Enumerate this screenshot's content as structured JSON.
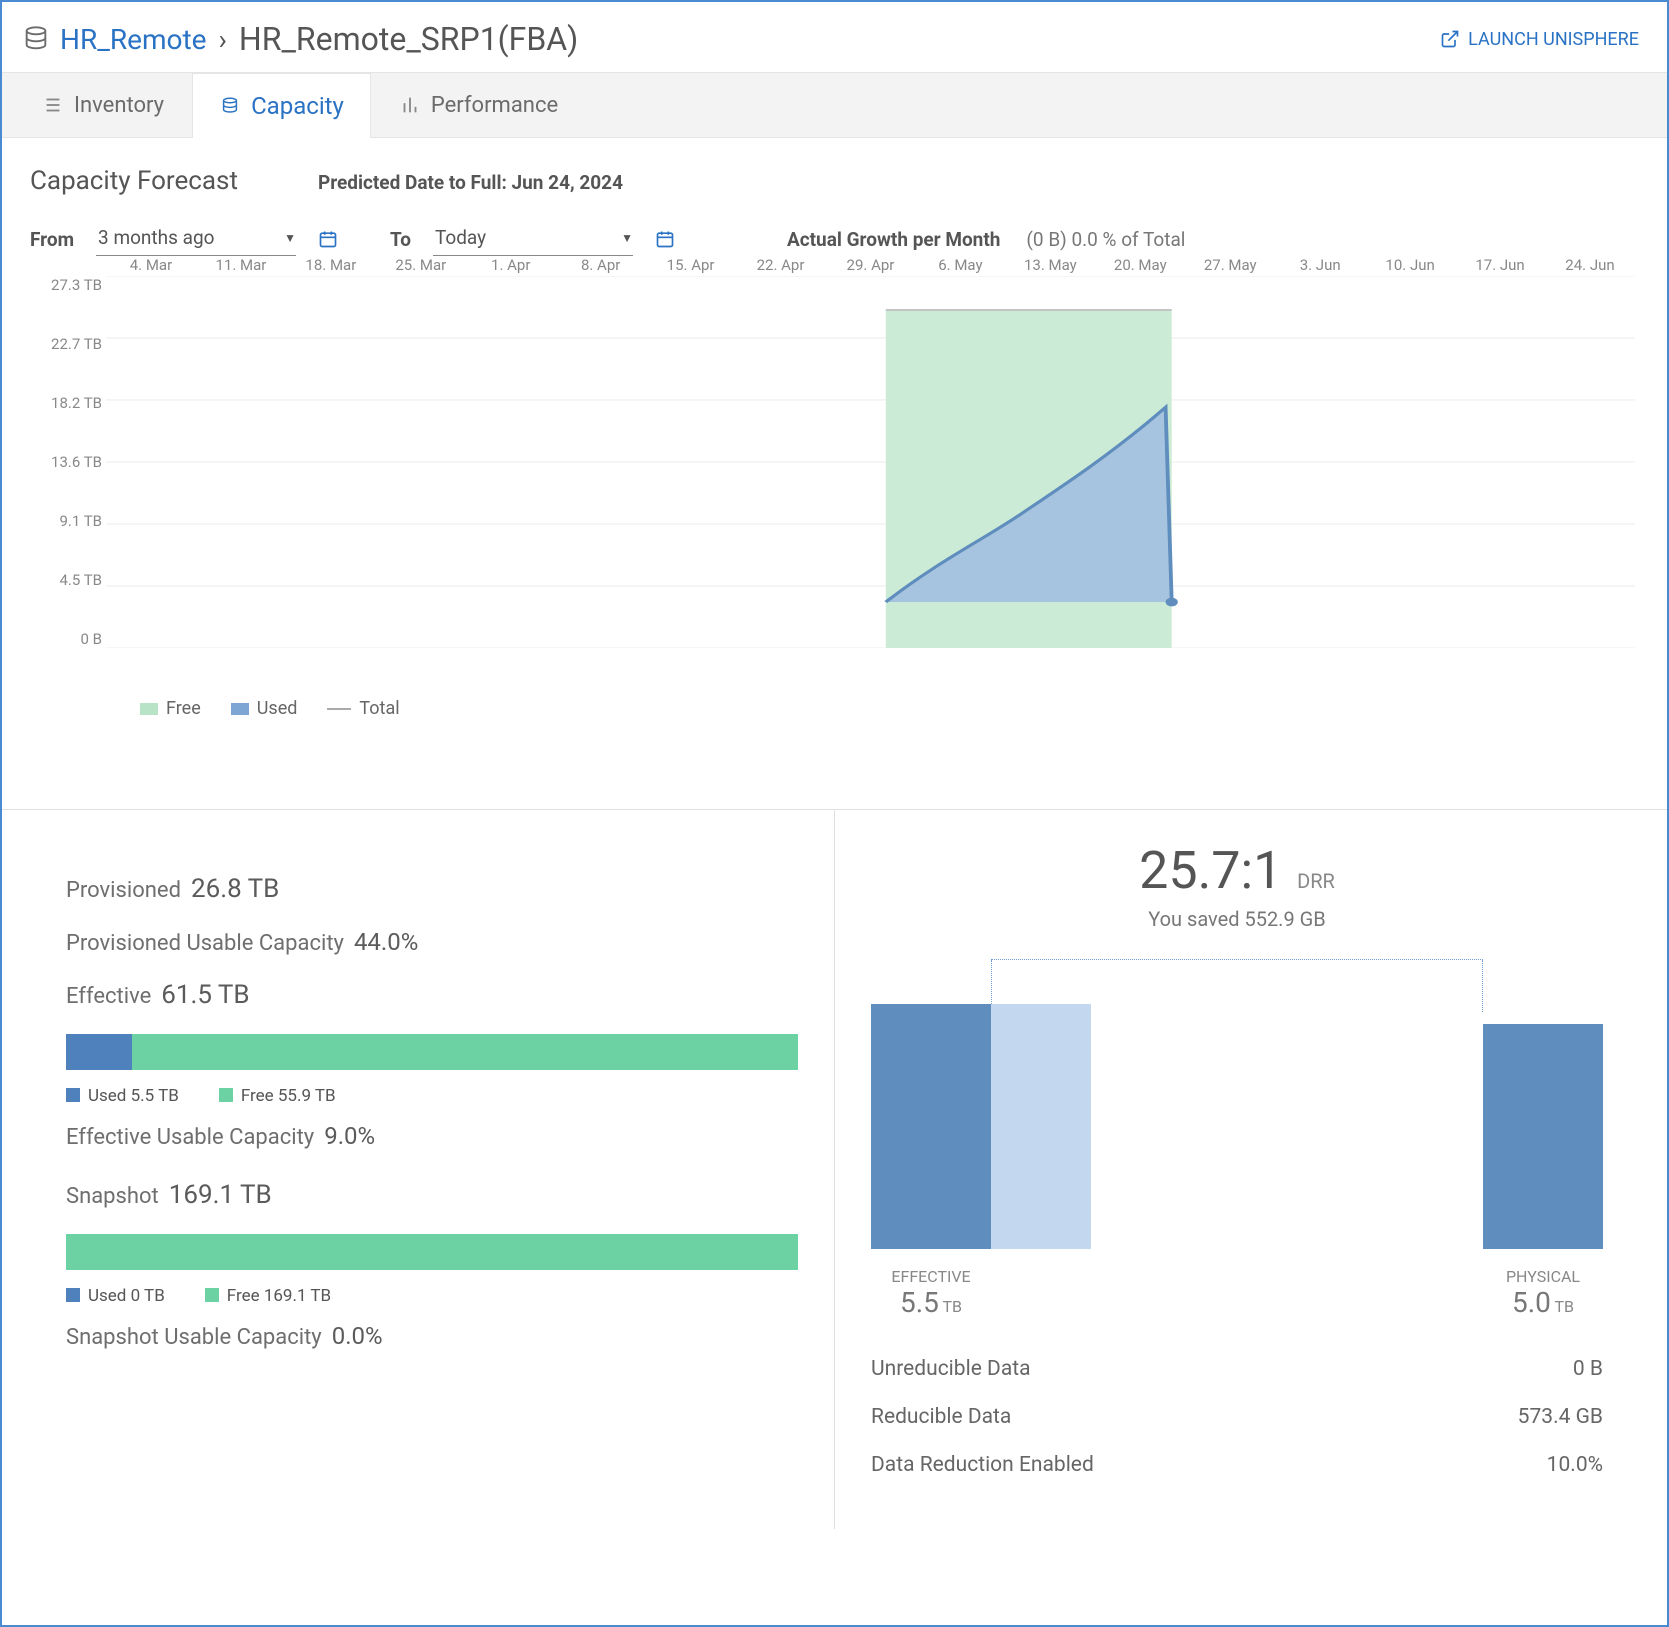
{
  "breadcrumb": {
    "parent": "HR_Remote",
    "current": "HR_Remote_SRP1(FBA)"
  },
  "actions": {
    "launch_label": "LAUNCH UNISPHERE"
  },
  "tabs": {
    "inventory": "Inventory",
    "capacity": "Capacity",
    "performance": "Performance",
    "active": "capacity"
  },
  "forecast": {
    "title": "Capacity Forecast",
    "predicted_label": "Predicted Date to Full: Jun 24, 2024",
    "from_label": "From",
    "to_label": "To",
    "from_value": "3 months ago",
    "to_value": "Today",
    "growth_label": "Actual Growth per Month",
    "growth_value": "(0 B) 0.0 % of Total",
    "legend_free": "Free",
    "legend_used": "Used",
    "legend_total": "Total"
  },
  "left_panel": {
    "provisioned_label": "Provisioned",
    "provisioned_value": "26.8 TB",
    "prov_usable_label": "Provisioned Usable Capacity",
    "prov_usable_value": "44.0%",
    "effective_label": "Effective",
    "effective_value": "61.5 TB",
    "eff_used_label": "Used 5.5 TB",
    "eff_free_label": "Free 55.9 TB",
    "eff_usable_label": "Effective Usable Capacity",
    "eff_usable_value": "9.0%",
    "snapshot_label": "Snapshot",
    "snapshot_value": "169.1 TB",
    "snap_used_label": "Used 0 TB",
    "snap_free_label": "Free 169.1 TB",
    "snap_usable_label": "Snapshot Usable Capacity",
    "snap_usable_value": "0.0%"
  },
  "right_panel": {
    "ratio": "25.7:1",
    "ratio_label": "DRR",
    "saved": "You saved 552.9 GB",
    "effective_label": "EFFECTIVE",
    "effective_value": "5.5",
    "effective_unit": "TB",
    "physical_label": "PHYSICAL",
    "physical_value": "5.0",
    "physical_unit": "TB",
    "unreducible_label": "Unreducible Data",
    "unreducible_value": "0 B",
    "reducible_label": "Reducible Data",
    "reducible_value": "573.4 GB",
    "reduction_enabled_label": "Data Reduction Enabled",
    "reduction_enabled_value": "10.0%"
  },
  "chart_data": {
    "type": "area",
    "title": "Capacity Forecast",
    "x_ticks": [
      "4. Mar",
      "11. Mar",
      "18. Mar",
      "25. Mar",
      "1. Apr",
      "8. Apr",
      "15. Apr",
      "22. Apr",
      "29. Apr",
      "6. May",
      "13. May",
      "20. May",
      "27. May",
      "3. Jun",
      "10. Jun",
      "17. Jun",
      "24. Jun"
    ],
    "y_ticks": [
      "27.3 TB",
      "22.7 TB",
      "18.2 TB",
      "13.6 TB",
      "9.1 TB",
      "4.5 TB",
      "0 B"
    ],
    "ylim_tb": [
      0,
      27.3
    ],
    "series": {
      "free": [
        {
          "x": "30. Apr",
          "y_tb": 24.9
        },
        {
          "x": "30. May",
          "y_tb": 24.9
        }
      ],
      "used": [
        {
          "x": "30. Apr",
          "y_tb": 3.4
        },
        {
          "x": "7. May",
          "y_tb": 7.7
        },
        {
          "x": "14. May",
          "y_tb": 10.0
        },
        {
          "x": "21. May",
          "y_tb": 13.2
        },
        {
          "x": "28. May",
          "y_tb": 17.7
        },
        {
          "x": "30. May",
          "y_tb": 3.4
        }
      ]
    }
  }
}
